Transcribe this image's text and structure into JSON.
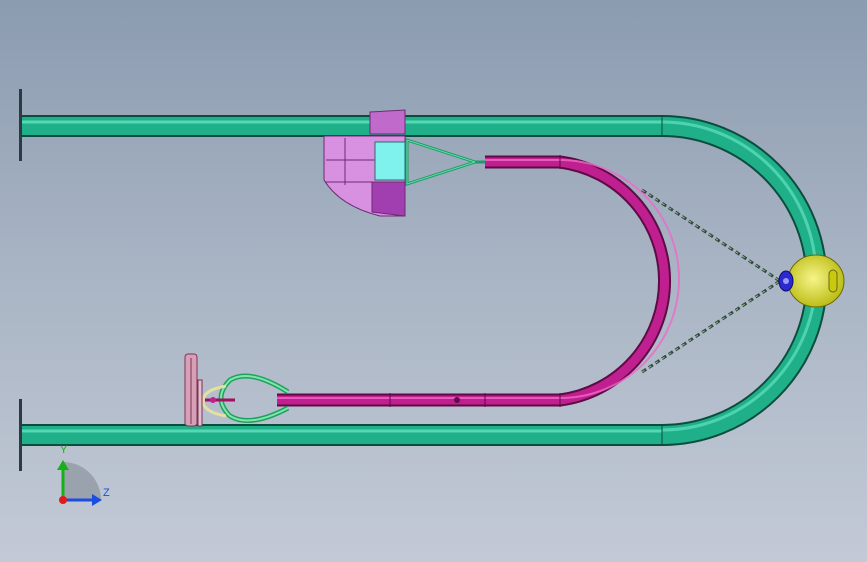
{
  "viewport": {
    "background_top": "#8b9bb0",
    "background_bottom": "#c3cad6"
  },
  "model": {
    "frame_tube_color": "#1fb08a",
    "hose_color": "#c0208f",
    "chain_color": "#3a6a4a",
    "bracket_color": "#38c07c",
    "seat_color": "#c06acb",
    "hub_color": "#e7e61a",
    "hub_center_color": "#2a2ad0"
  },
  "triad": {
    "y_label": "Y",
    "z_label": "Z",
    "y_color": "#18b018",
    "z_color": "#1a4de0",
    "x_color": "#e01a1a"
  }
}
